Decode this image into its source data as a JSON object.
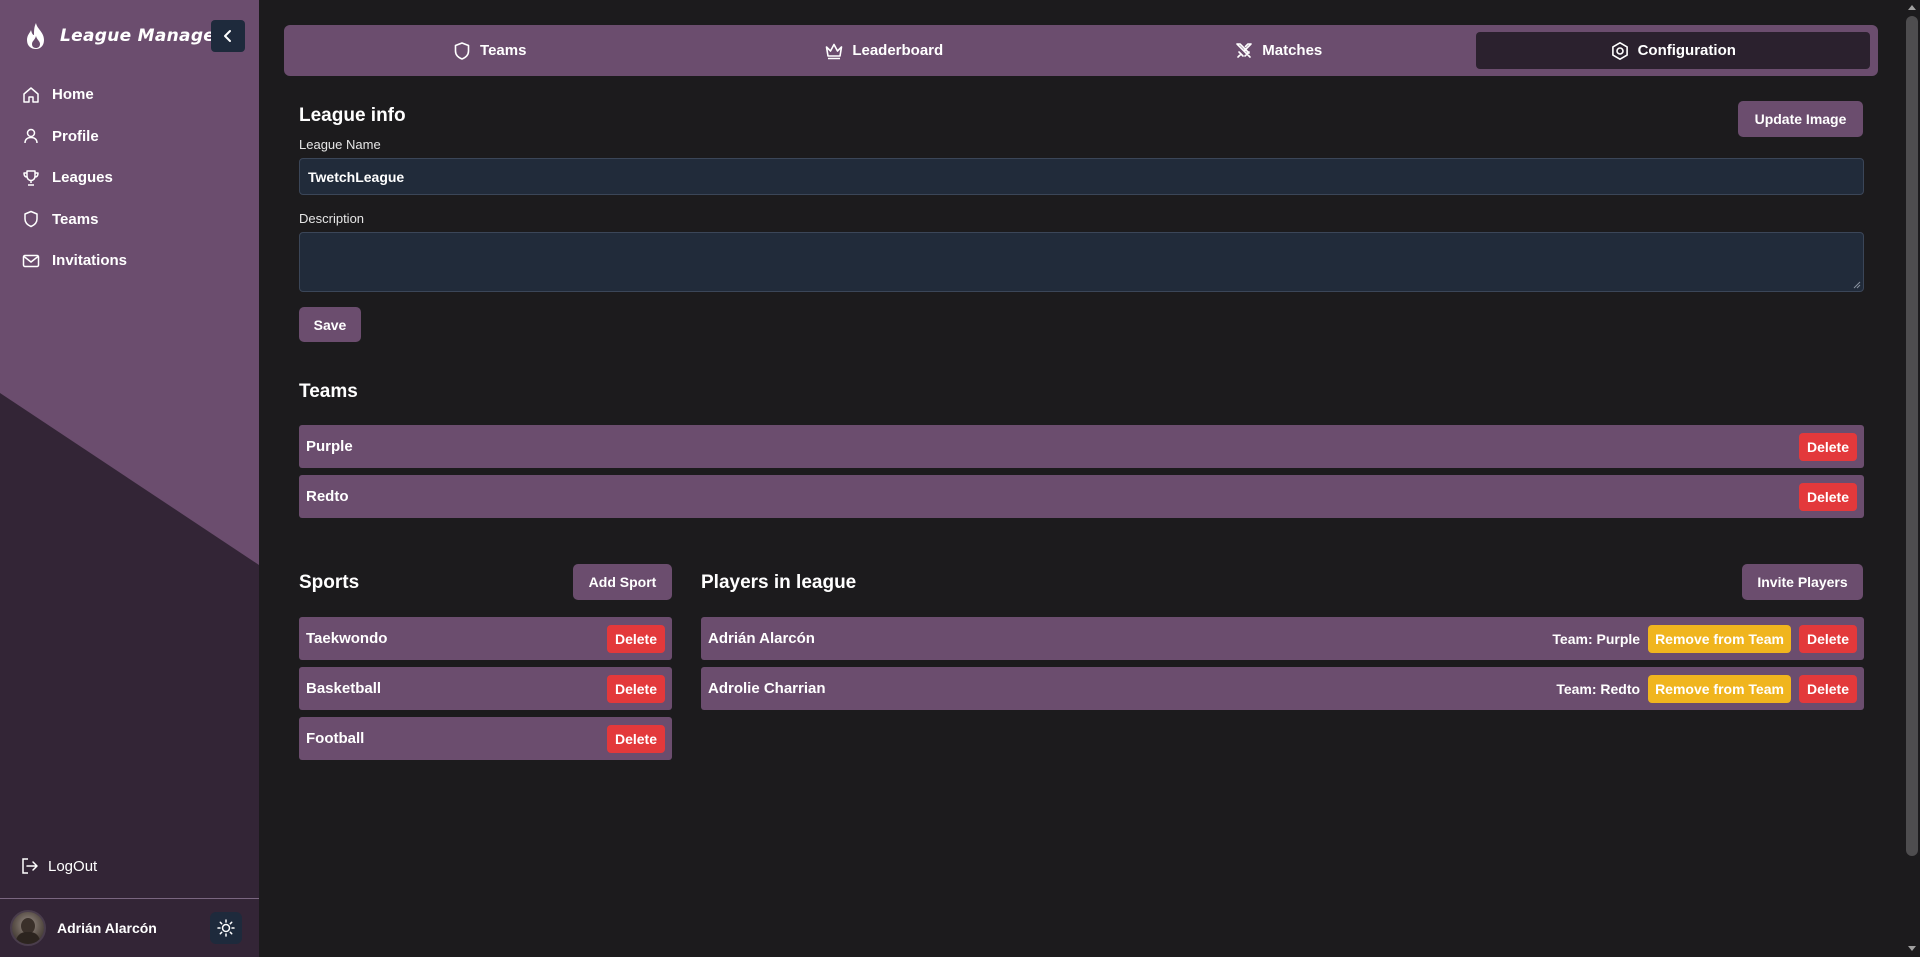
{
  "app": {
    "title": "League Manager"
  },
  "sidebar": {
    "items": [
      {
        "label": "Home",
        "icon": "home-icon"
      },
      {
        "label": "Profile",
        "icon": "user-icon"
      },
      {
        "label": "Leagues",
        "icon": "trophy-icon"
      },
      {
        "label": "Teams",
        "icon": "shield-icon"
      },
      {
        "label": "Invitations",
        "icon": "mail-icon"
      }
    ],
    "logout_label": "LogOut",
    "user_name": "Adrián Alarcón"
  },
  "tabs": [
    {
      "label": "Teams",
      "icon": "shield-icon"
    },
    {
      "label": "Leaderboard",
      "icon": "crown-icon"
    },
    {
      "label": "Matches",
      "icon": "crossed-swords-icon"
    },
    {
      "label": "Configuration",
      "icon": "settings-icon",
      "active": true
    }
  ],
  "league_info": {
    "heading": "League info",
    "update_image_label": "Update Image",
    "name_label": "League Name",
    "name_value": "TwetchLeague",
    "description_label": "Description",
    "description_value": "",
    "save_label": "Save"
  },
  "teams_section": {
    "heading": "Teams",
    "items": [
      {
        "name": "Purple",
        "delete_label": "Delete"
      },
      {
        "name": "Redto",
        "delete_label": "Delete"
      }
    ]
  },
  "sports_section": {
    "heading": "Sports",
    "add_label": "Add Sport",
    "items": [
      {
        "name": "Taekwondo",
        "delete_label": "Delete"
      },
      {
        "name": "Basketball",
        "delete_label": "Delete"
      },
      {
        "name": "Football",
        "delete_label": "Delete"
      }
    ]
  },
  "players_section": {
    "heading": "Players in league",
    "invite_label": "Invite Players",
    "items": [
      {
        "name": "Adrián Alarcón",
        "team": "Team: Purple",
        "remove_label": "Remove from Team",
        "delete_label": "Delete"
      },
      {
        "name": "Adrolie Charrian",
        "team": "Team: Redto",
        "remove_label": "Remove from Team",
        "delete_label": "Delete"
      }
    ]
  },
  "colors": {
    "sidebar_light": "#6b4d6e",
    "sidebar_dark": "#332536",
    "accent": "#6b4d6e",
    "background": "#1c1b1d",
    "danger": "#e3393b",
    "warning": "#f0b51e"
  }
}
